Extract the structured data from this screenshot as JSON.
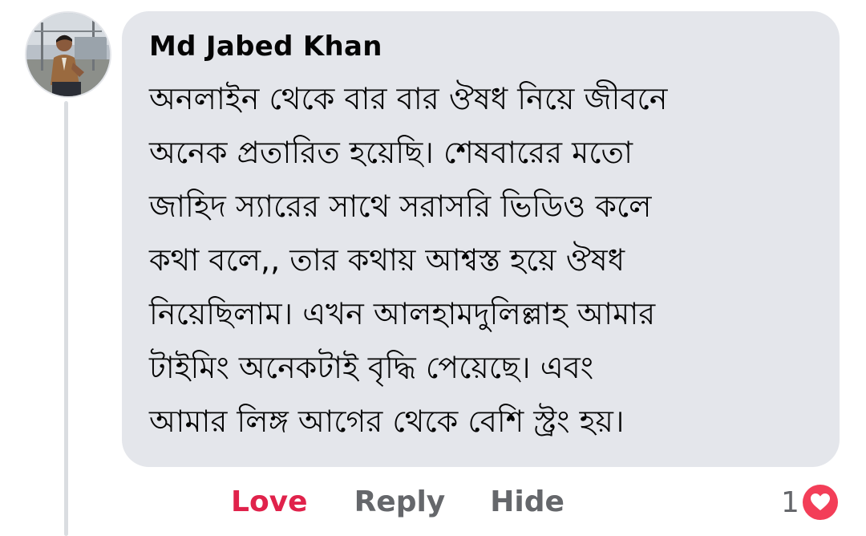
{
  "comment": {
    "author_name": "Md Jabed Khan",
    "text": "অনলাইন থেকে বার বার ঔষধ নিয়ে জীবনে\nঅনেক প্রতারিত হয়েছি। শেষবারের মতো\nজাহিদ স্যারের সাথে সরাসরি ভিডিও কলে\nকথা বলে,, তার কথায় আশ্বস্ত হয়ে ঔষধ\nনিয়েছিলাম। এখন আলহামদুলিল্লাহ আমার\nটাইমিং অনেকটাই বৃদ্ধি পেয়েছে। এবং\nআমার লিঙ্গ আগের থেকে বেশি স্ট্রং হয়।",
    "avatar_icon": "user-avatar-photo"
  },
  "actions": {
    "love_label": "Love",
    "reply_label": "Reply",
    "hide_label": "Hide"
  },
  "reactions": {
    "count": "1",
    "icon": "love-heart-icon"
  },
  "colors": {
    "love_active": "#e0224b",
    "action_gray": "#65676b",
    "bubble_bg": "#e4e6eb",
    "love_reaction": "#f33e58"
  }
}
